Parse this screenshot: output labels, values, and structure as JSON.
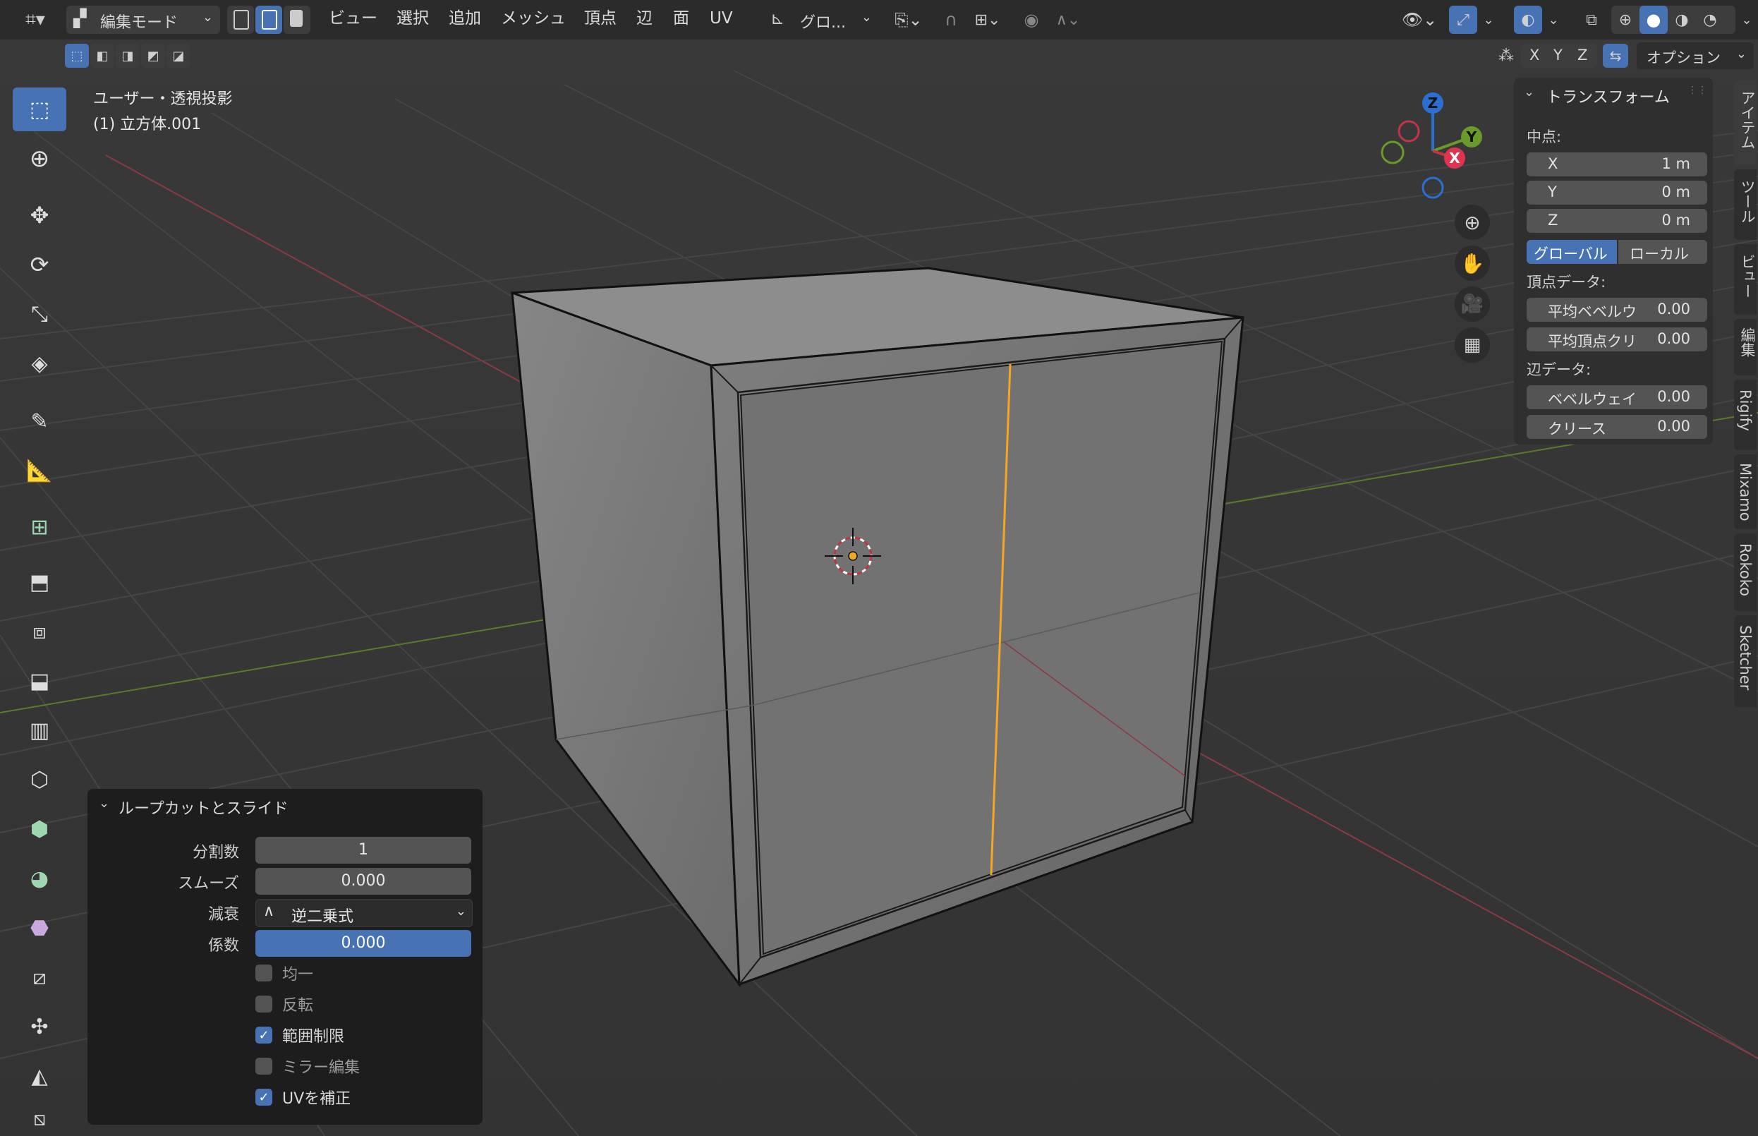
{
  "header": {
    "mode": "編集モード",
    "menus": [
      "ビュー",
      "選択",
      "追加",
      "メッシュ",
      "頂点",
      "辺",
      "面",
      "UV"
    ],
    "transform_orientation": "グロ...",
    "axes": [
      "X",
      "Y",
      "Z"
    ],
    "options": "オプション"
  },
  "viewport": {
    "view_name": "ユーザー・透視投影",
    "object_name": "(1) 立方体.001"
  },
  "gizmo": {
    "x": "X",
    "y": "Y",
    "z": "Z"
  },
  "transform_panel": {
    "title": "トランスフォーム",
    "median_label": "中点:",
    "x_label": "X",
    "x_value": "1 m",
    "y_label": "Y",
    "y_value": "0 m",
    "z_label": "Z",
    "z_value": "0 m",
    "global": "グローバル",
    "local": "ローカル",
    "vertex_data": "頂点データ:",
    "mean_bevel_weight": "平均ベベルウ",
    "mean_bevel_weight_value": "0.00",
    "mean_vertex_crease": "平均頂点クリ",
    "mean_vertex_crease_value": "0.00",
    "edge_data": "辺データ:",
    "bevel_weight": "ベベルウェイ",
    "bevel_weight_value": "0.00",
    "crease": "クリース",
    "crease_value": "0.00"
  },
  "side_tabs": [
    "アイテム",
    "ツール",
    "ビュー",
    "編集",
    "Rigify",
    "Mixamo",
    "Rokoko",
    "Sketcher"
  ],
  "operator_panel": {
    "title": "ループカットとスライド",
    "cuts_label": "分割数",
    "cuts_value": "1",
    "smooth_label": "スムーズ",
    "smooth_value": "0.000",
    "falloff_label": "減衰",
    "falloff_value": "逆二乗式",
    "factor_label": "係数",
    "factor_value": "0.000",
    "even": "均一",
    "even_checked": false,
    "flip": "反転",
    "flip_checked": false,
    "clamp": "範囲制限",
    "clamp_checked": true,
    "mirror": "ミラー編集",
    "mirror_checked": false,
    "correct_uv": "UVを補正",
    "correct_uv_checked": true
  },
  "colors": {
    "accent": "#4772b3",
    "x_axis": "#c23446",
    "y_axis": "#6a9a2a",
    "z_axis": "#2a6fd1",
    "selected_edge": "#f5a623"
  }
}
